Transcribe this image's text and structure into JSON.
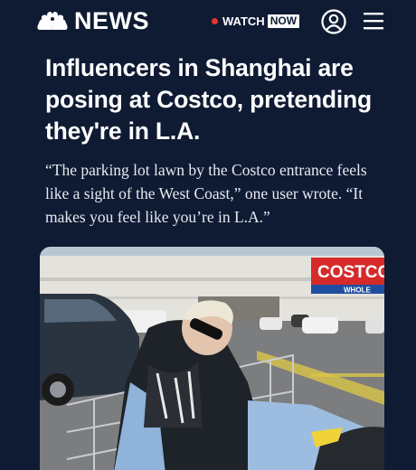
{
  "header": {
    "logo_text": "NEWS",
    "logo_icon": "peacock-icon",
    "watch_label": "WATCH",
    "now_badge": "NOW",
    "account_icon": "account-icon",
    "menu_icon": "hamburger-menu-icon"
  },
  "article": {
    "headline": "Influencers in Shanghai are posing at Costco, pretending they're in L.A.",
    "dek": "“The parking lot lawn by the Costco entrance feels like a sight of the West Coast,” one user wrote. “It makes you feel like you’re in L.A.”",
    "photo": {
      "store_sign": "COSTCO",
      "store_sign_sub": "WHOLE"
    }
  },
  "colors": {
    "background": "#0f1b33",
    "live_dot": "#e8322b",
    "costco_red": "#d62a2a",
    "costco_blue": "#1f4ea1"
  }
}
